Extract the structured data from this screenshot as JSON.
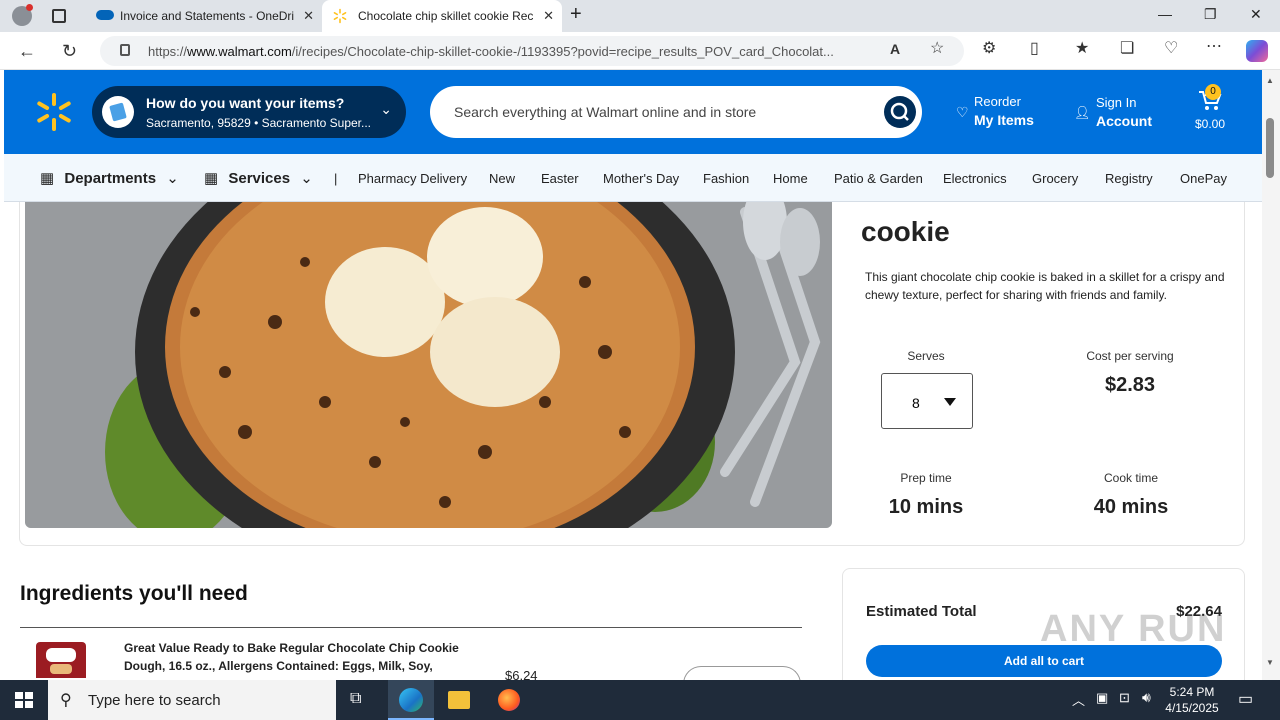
{
  "browser": {
    "tabs": [
      {
        "title": "Invoice and Statements - OneDri",
        "icon": "onedrive-cloud-icon"
      },
      {
        "title": "Chocolate chip skillet cookie Rec",
        "icon": "walmart-spark-icon"
      }
    ],
    "url_prefix": "https://",
    "url_domain": "www.walmart.com",
    "url_path": "/i/recipes/Chocolate-chip-skillet-cookie-/1193395?povid=recipe_results_POV_card_Chocolat..."
  },
  "header": {
    "delivery_title": "How do you want your items?",
    "delivery_location": "Sacramento, 95829 • Sacramento Super...",
    "search_placeholder": "Search everything at Walmart online and in store",
    "reorder_label": "Reorder",
    "reorder_sub": "My Items",
    "signin_label": "Sign In",
    "signin_sub": "Account",
    "cart_count": "0",
    "cart_total": "$0.00",
    "brand_color": "#0071dc"
  },
  "nav": {
    "departments": "Departments",
    "services": "Services",
    "separator": "|",
    "items": [
      "Pharmacy Delivery",
      "New",
      "Easter",
      "Mother's Day",
      "Fashion",
      "Home",
      "Patio & Garden",
      "Electronics",
      "Grocery",
      "Registry",
      "OnePay"
    ]
  },
  "recipe": {
    "title_visible": "cookie",
    "description": "This giant chocolate chip cookie is baked in a skillet for a crispy and chewy texture, perfect for sharing with friends and family.",
    "serves_label": "Serves",
    "serves_value": "8",
    "cost_label": "Cost per serving",
    "cost_value": "$2.83",
    "prep_label": "Prep time",
    "prep_value": "10 mins",
    "cook_label": "Cook time",
    "cook_value": "40 mins"
  },
  "ingredients": {
    "heading": "Ingredients you'll need",
    "items": [
      {
        "name": "Great Value Ready to Bake Regular Chocolate Chip Cookie Dough, 16.5 oz., Allergens Contained: Eggs, Milk, Soy,",
        "price": "$6.24"
      }
    ]
  },
  "summary": {
    "total_label": "Estimated Total",
    "total_value": "$22.64",
    "add_all_label": "Add all to cart"
  },
  "watermark": "ANY RUN",
  "taskbar": {
    "search_placeholder": "Type here to search",
    "time": "5:24 PM",
    "date": "4/15/2025"
  }
}
